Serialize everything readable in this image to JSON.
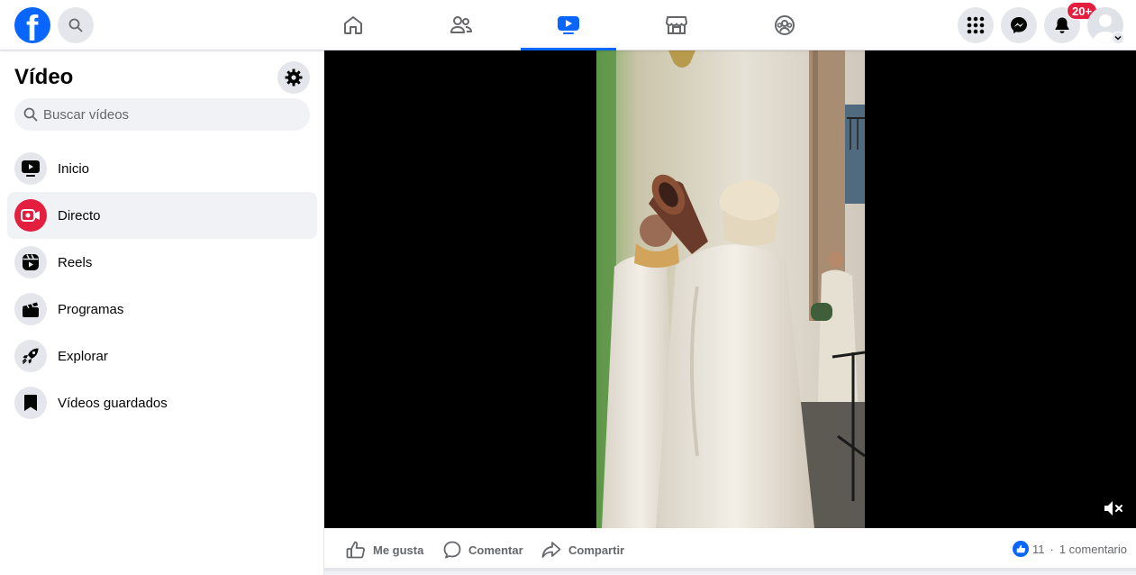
{
  "header": {
    "logo_letter": "f",
    "notifications_badge": "20+",
    "active_tab": "watch",
    "tabs": [
      "home",
      "friends",
      "watch",
      "marketplace",
      "groups"
    ]
  },
  "sidebar": {
    "title": "Vídeo",
    "search_placeholder": "Buscar vídeos",
    "items": [
      {
        "label": "Inicio",
        "icon": "tv-play-icon"
      },
      {
        "label": "Directo",
        "icon": "live-video-icon",
        "active": true
      },
      {
        "label": "Reels",
        "icon": "reels-icon"
      },
      {
        "label": "Programas",
        "icon": "clapperboard-icon"
      },
      {
        "label": "Explorar",
        "icon": "rocket-icon"
      },
      {
        "label": "Vídeos guardados",
        "icon": "bookmark-icon"
      }
    ]
  },
  "post_actions": {
    "like_label": "Me gusta",
    "comment_label": "Comentar",
    "share_label": "Compartir",
    "like_count": "11",
    "separator": "·",
    "comment_count": "1 comentario"
  },
  "colors": {
    "brand_blue": "#0866ff",
    "badge_red": "#e41e3f",
    "live_red": "#e41e3f"
  }
}
